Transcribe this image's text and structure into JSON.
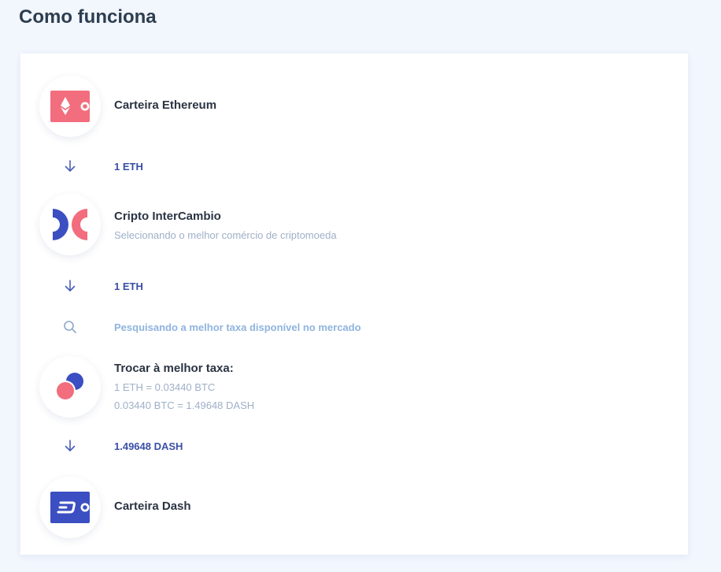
{
  "page": {
    "title": "Como funciona"
  },
  "steps": {
    "wallet_eth": {
      "title": "Carteira Ethereum",
      "icon": "ethereum-wallet-icon"
    },
    "amount_1": "1 ETH",
    "exchange": {
      "title": "Cripto InterCambio",
      "subtitle": "Selecionando o melhor comércio de criptomoeda",
      "icon": "intercambio-logo-icon"
    },
    "amount_2": "1 ETH",
    "search": {
      "text": "Pesquisando a melhor taxa disponível no mercado",
      "icon": "search-icon"
    },
    "trade": {
      "title": "Trocar à melhor taxa:",
      "rate_1": "1 ETH = 0.03440 BTC",
      "rate_2": "0.03440 BTC = 1.49648 DASH",
      "icon": "trade-icon"
    },
    "amount_3": "1.49648 DASH",
    "wallet_dash": {
      "title": "Carteira Dash",
      "icon": "dash-wallet-icon"
    }
  },
  "colors": {
    "background": "#f2f6fd",
    "card": "#ffffff",
    "accent_pink": "#f26d7d",
    "accent_blue": "#3b4ec2",
    "amount_text": "#3a4fa6",
    "muted_text": "#9fb0c8",
    "search_text": "#8fb4de"
  }
}
